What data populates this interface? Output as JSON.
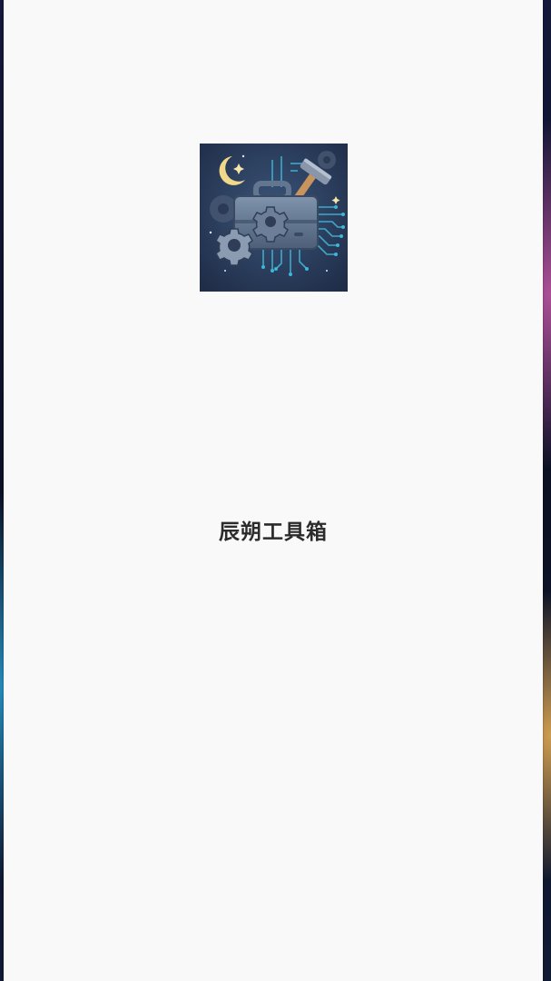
{
  "splash": {
    "app_name": "辰朔工具箱",
    "logo_icon": "toolbox-gear-hammer-icon"
  },
  "colors": {
    "background": "#f9f9f9",
    "title_text": "#2b2b2b",
    "icon_bg": "#2d3e5c",
    "accent_cyan": "#3fb6d6",
    "moon": "#f1d98a"
  }
}
